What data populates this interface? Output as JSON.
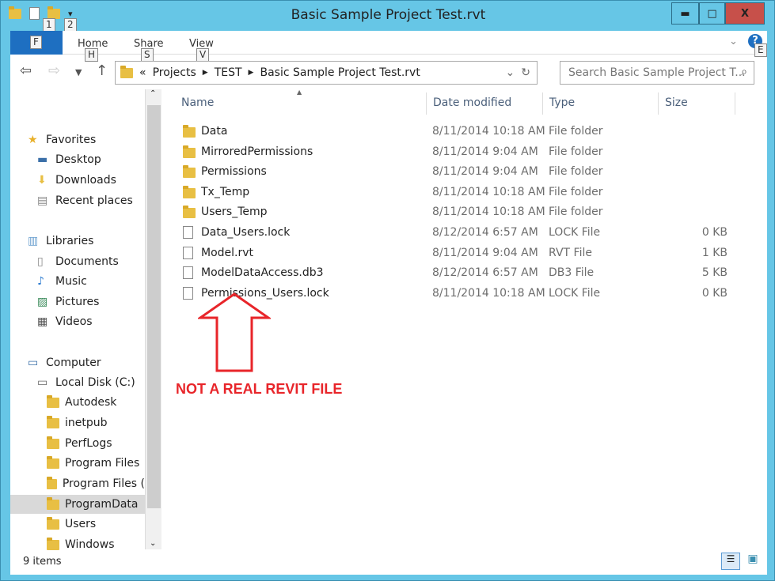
{
  "window": {
    "title": "Basic Sample Project Test.rvt",
    "minimize": "▬",
    "maximize": "□",
    "close": "X"
  },
  "qat_keys": [
    "1",
    "2"
  ],
  "ribbon": {
    "file_key": "F",
    "tabs": [
      {
        "label": "Home",
        "key": "H"
      },
      {
        "label": "Share",
        "key": "S"
      },
      {
        "label": "View",
        "key": "V"
      }
    ],
    "help_key": "E"
  },
  "address": {
    "prefix": "«",
    "crumbs": [
      "Projects",
      "TEST",
      "Basic Sample Project Test.rvt"
    ]
  },
  "search": {
    "placeholder": "Search Basic Sample Project T..."
  },
  "sidebar": [
    {
      "label": "Favorites",
      "icon": "star-icon",
      "level": 0
    },
    {
      "label": "Desktop",
      "icon": "desktop-icon",
      "level": 1
    },
    {
      "label": "Downloads",
      "icon": "downloads-icon",
      "level": 1
    },
    {
      "label": "Recent places",
      "icon": "recent-places-icon",
      "level": 1
    },
    {
      "label": "Libraries",
      "icon": "libraries-icon",
      "level": 0
    },
    {
      "label": "Documents",
      "icon": "documents-icon",
      "level": 1
    },
    {
      "label": "Music",
      "icon": "music-icon",
      "level": 1
    },
    {
      "label": "Pictures",
      "icon": "pictures-icon",
      "level": 1
    },
    {
      "label": "Videos",
      "icon": "videos-icon",
      "level": 1
    },
    {
      "label": "Computer",
      "icon": "computer-icon",
      "level": 0
    },
    {
      "label": "Local Disk (C:)",
      "icon": "drive-icon",
      "level": 1
    },
    {
      "label": "Autodesk",
      "icon": "folder-icon",
      "level": 2
    },
    {
      "label": "inetpub",
      "icon": "folder-icon",
      "level": 2
    },
    {
      "label": "PerfLogs",
      "icon": "folder-icon",
      "level": 2
    },
    {
      "label": "Program Files",
      "icon": "folder-icon",
      "level": 2
    },
    {
      "label": "Program Files (",
      "icon": "folder-icon",
      "level": 2
    },
    {
      "label": "ProgramData",
      "icon": "folder-icon",
      "level": 2,
      "selected": true
    },
    {
      "label": "Users",
      "icon": "folder-icon",
      "level": 2
    },
    {
      "label": "Windows",
      "icon": "folder-icon",
      "level": 2
    }
  ],
  "columns": [
    "Name",
    "Date modified",
    "Type",
    "Size"
  ],
  "files": [
    {
      "name": "Data",
      "date": "8/11/2014 10:18 AM",
      "type": "File folder",
      "size": "",
      "folder": true
    },
    {
      "name": "MirroredPermissions",
      "date": "8/11/2014 9:04 AM",
      "type": "File folder",
      "size": "",
      "folder": true
    },
    {
      "name": "Permissions",
      "date": "8/11/2014 9:04 AM",
      "type": "File folder",
      "size": "",
      "folder": true
    },
    {
      "name": "Tx_Temp",
      "date": "8/11/2014 10:18 AM",
      "type": "File folder",
      "size": "",
      "folder": true
    },
    {
      "name": "Users_Temp",
      "date": "8/11/2014 10:18 AM",
      "type": "File folder",
      "size": "",
      "folder": true
    },
    {
      "name": "Data_Users.lock",
      "date": "8/12/2014 6:57 AM",
      "type": "LOCK File",
      "size": "0 KB",
      "folder": false
    },
    {
      "name": "Model.rvt",
      "date": "8/11/2014 9:04 AM",
      "type": "RVT File",
      "size": "1 KB",
      "folder": false
    },
    {
      "name": "ModelDataAccess.db3",
      "date": "8/12/2014 6:57 AM",
      "type": "DB3 File",
      "size": "5 KB",
      "folder": false
    },
    {
      "name": "Permissions_Users.lock",
      "date": "8/11/2014 10:18 AM",
      "type": "LOCK File",
      "size": "0 KB",
      "folder": false
    }
  ],
  "status": "9 items",
  "annotation": {
    "text": "NOT A REAL REVIT FILE",
    "color": "#e8252a"
  }
}
